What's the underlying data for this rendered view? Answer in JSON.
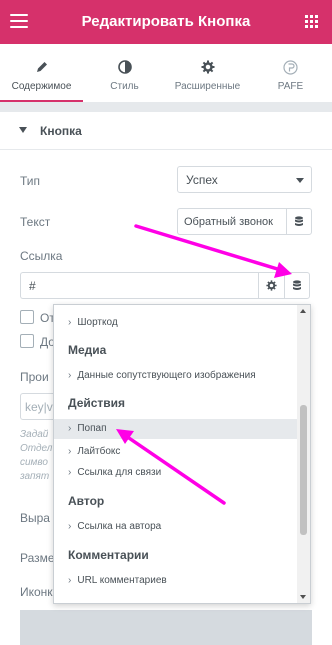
{
  "header": {
    "title": "Редактировать Кнопка"
  },
  "tabs": [
    {
      "label": "Содержимое",
      "icon": "pencil-icon",
      "active": true
    },
    {
      "label": "Стиль",
      "icon": "half-circle-icon",
      "active": false
    },
    {
      "label": "Расширенные",
      "icon": "gear-icon",
      "active": false
    },
    {
      "label": "PAFE",
      "icon": "pafe-logo-icon",
      "active": false
    }
  ],
  "section": {
    "title": "Кнопка"
  },
  "fields": {
    "type_label": "Тип",
    "type_value": "Успех",
    "text_label": "Текст",
    "text_value": "Обратный звонок",
    "link_label": "Ссылка",
    "link_value": "#",
    "partial_1": "От",
    "partial_2": "До",
    "partial_3": "Прои",
    "partial_4": "key|v",
    "hint_lines": [
      "Задай",
      "Отдел",
      "симво",
      "запят"
    ],
    "partial_5": "Выра",
    "partial_6": "Разме",
    "partial_7": "Иконк"
  },
  "dropdown": {
    "items": [
      {
        "kind": "item",
        "label": "Шорткод"
      },
      {
        "kind": "group",
        "label": "Медиа"
      },
      {
        "kind": "item",
        "label": "Данные сопутствующего изображения"
      },
      {
        "kind": "group",
        "label": "Действия"
      },
      {
        "kind": "item",
        "label": "Попап",
        "highlighted": true
      },
      {
        "kind": "item",
        "label": "Лайтбокс"
      },
      {
        "kind": "item",
        "label": "Ссылка для связи"
      },
      {
        "kind": "group",
        "label": "Автор"
      },
      {
        "kind": "item",
        "label": "Ссылка на автора"
      },
      {
        "kind": "group",
        "label": "Комментарии"
      },
      {
        "kind": "item",
        "label": "URL комментариев"
      }
    ]
  },
  "colors": {
    "brand": "#d6316b",
    "annotation_arrow": "#ff00e6",
    "highlight": "#e6e9ec"
  }
}
